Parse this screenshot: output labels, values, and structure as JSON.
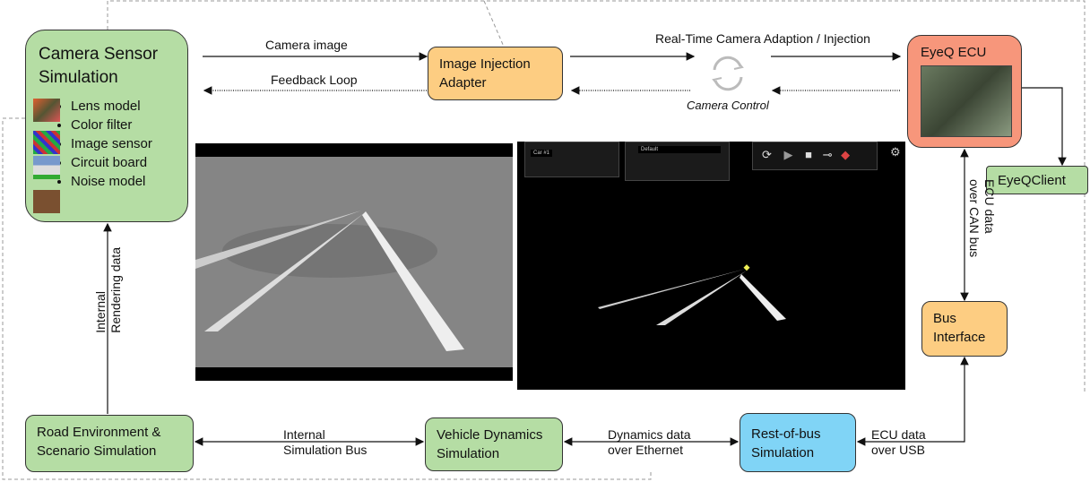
{
  "camera_sensor": {
    "title_line1": "Camera  Sensor",
    "title_line2": "Simulation",
    "items": [
      "Lens model",
      "Color filter",
      "Image sensor",
      "Circuit board",
      "Noise model"
    ]
  },
  "image_injection": {
    "line1": "Image Injection",
    "line2": "Adapter"
  },
  "eyeq_ecu": {
    "title": "EyeQ ECU"
  },
  "eyeq_client": {
    "title": "EyeQClient"
  },
  "bus_interface": {
    "line1": "Bus",
    "line2": "Interface"
  },
  "road_env": {
    "line1": "Road Environment &",
    "line2": "Scenario Simulation"
  },
  "vehicle_dynamics": {
    "line1": "Vehicle Dynamics",
    "line2": "Simulation"
  },
  "rest_of_bus": {
    "line1": "Rest-of-bus",
    "line2": "Simulation"
  },
  "labels": {
    "camera_image": "Camera image",
    "feedback_loop": "Feedback Loop",
    "realtime": "Real-Time Camera Adaption / Injection",
    "camera_control": "Camera Control",
    "ecu_can_1": "ECU data",
    "ecu_can_2": "over CAN bus",
    "internal_1": "Internal",
    "internal_2": "Rendering data",
    "sim_bus_1": "Internal",
    "sim_bus_2": "Simulation Bus",
    "dyn_1": "Dynamics data",
    "dyn_2": "over Ethernet",
    "usb_1": "ECU data",
    "usb_2": "over USB"
  },
  "screenshot_ui": {
    "car_select": "Car #1",
    "profile_select": "Default"
  },
  "colors": {
    "green": "#b5dda4",
    "orange": "#fdcd82",
    "salmon": "#f7967b",
    "blue": "#80d4f6"
  }
}
